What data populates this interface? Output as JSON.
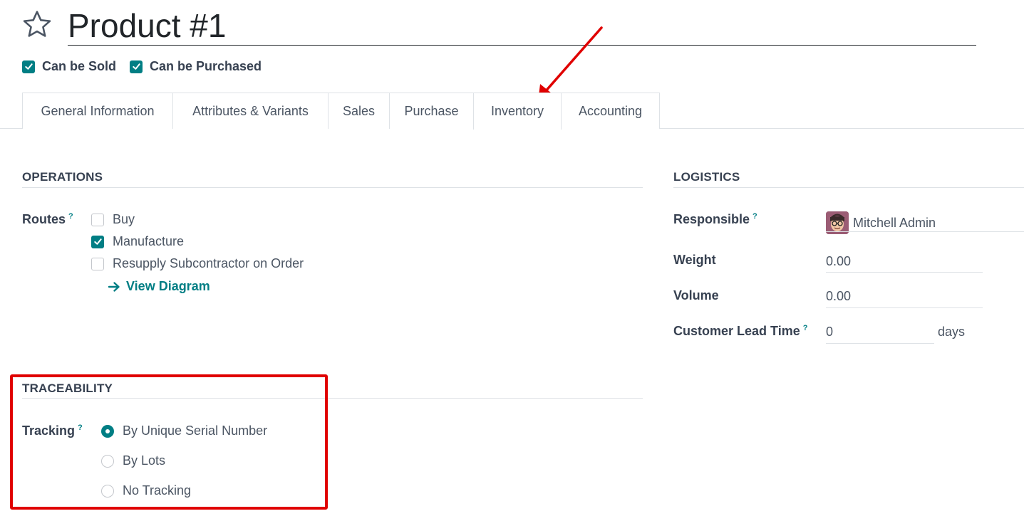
{
  "header": {
    "title": "Product #1",
    "can_be_sold_label": "Can be Sold",
    "can_be_sold": true,
    "can_be_purchased_label": "Can be Purchased",
    "can_be_purchased": true
  },
  "tabs": [
    {
      "label": "General Information"
    },
    {
      "label": "Attributes & Variants"
    },
    {
      "label": "Sales"
    },
    {
      "label": "Purchase"
    },
    {
      "label": "Inventory",
      "active": true
    },
    {
      "label": "Accounting"
    }
  ],
  "operations": {
    "title": "OPERATIONS",
    "routes_label": "Routes",
    "help_mark": "?",
    "routes": [
      {
        "label": "Buy",
        "checked": false
      },
      {
        "label": "Manufacture",
        "checked": true
      },
      {
        "label": "Resupply Subcontractor on Order",
        "checked": false
      }
    ],
    "view_diagram_label": "View Diagram"
  },
  "logistics": {
    "title": "LOGISTICS",
    "responsible_label": "Responsible",
    "responsible_value": "Mitchell Admin",
    "weight_label": "Weight",
    "weight_value": "0.00",
    "volume_label": "Volume",
    "volume_value": "0.00",
    "lead_time_label": "Customer Lead Time",
    "lead_time_value": "0",
    "lead_time_unit": "days"
  },
  "traceability": {
    "title": "TRACEABILITY",
    "tracking_label": "Tracking",
    "options": [
      {
        "label": "By Unique Serial Number",
        "selected": true
      },
      {
        "label": "By Lots",
        "selected": false
      },
      {
        "label": "No Tracking",
        "selected": false
      }
    ]
  },
  "colors": {
    "accent": "#017e84",
    "annotation": "#e00000"
  }
}
